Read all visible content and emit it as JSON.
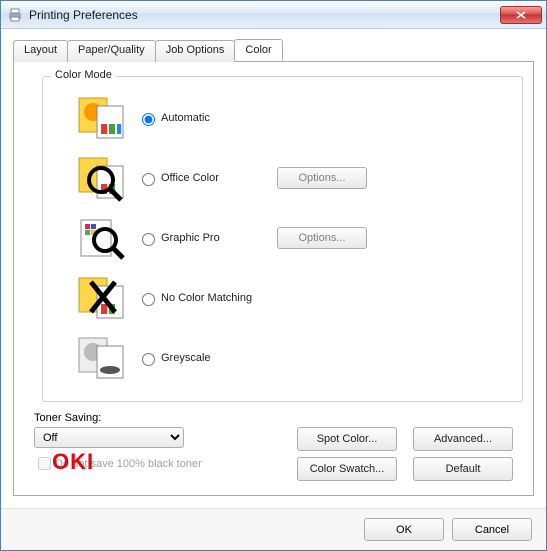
{
  "window": {
    "title": "Printing Preferences"
  },
  "tabs": {
    "t0": "Layout",
    "t1": "Paper/Quality",
    "t2": "Job Options",
    "t3": "Color"
  },
  "color_mode": {
    "legend": "Color Mode",
    "automatic": "Automatic",
    "office": "Office Color",
    "graphic": "Graphic Pro",
    "nomatch": "No Color Matching",
    "greyscale": "Greyscale",
    "options_btn": "Options..."
  },
  "toner": {
    "label": "Toner Saving:",
    "value": "Off",
    "checkbox": "Do not save 100% black toner"
  },
  "buttons": {
    "spot": "Spot Color...",
    "advanced": "Advanced...",
    "swatch": "Color Swatch...",
    "default": "Default",
    "ok": "OK",
    "cancel": "Cancel"
  },
  "logo": "OKI"
}
